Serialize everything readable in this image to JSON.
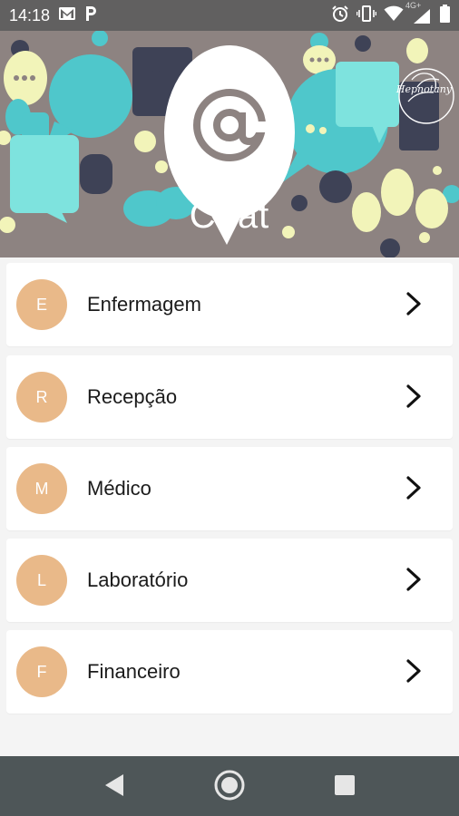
{
  "status_bar": {
    "time": "14:18",
    "network_label": "4G+",
    "icons": [
      "gmail-icon",
      "p-app-icon",
      "alarm-icon",
      "vibrate-icon",
      "wifi-icon",
      "signal-icon",
      "battery-icon"
    ]
  },
  "header": {
    "title": "Chat",
    "logo_text": "Hepnotany"
  },
  "items": [
    {
      "initial": "E",
      "label": "Enfermagem"
    },
    {
      "initial": "R",
      "label": "Recepção"
    },
    {
      "initial": "M",
      "label": "Médico"
    },
    {
      "initial": "L",
      "label": "Laboratório"
    },
    {
      "initial": "F",
      "label": "Financeiro"
    }
  ],
  "colors": {
    "avatar": "#e9b989",
    "header_bg": "#8d8381",
    "status_bar": "#616060",
    "nav_bar": "#4e5658",
    "page_bg": "#f4f4f4",
    "bubble_teal": "#4fc7cb",
    "bubble_yellow": "#f2f4b9",
    "bubble_navy": "#3e4256"
  },
  "nav_bar": {
    "icons": [
      "back-icon",
      "home-icon",
      "recents-icon"
    ]
  }
}
